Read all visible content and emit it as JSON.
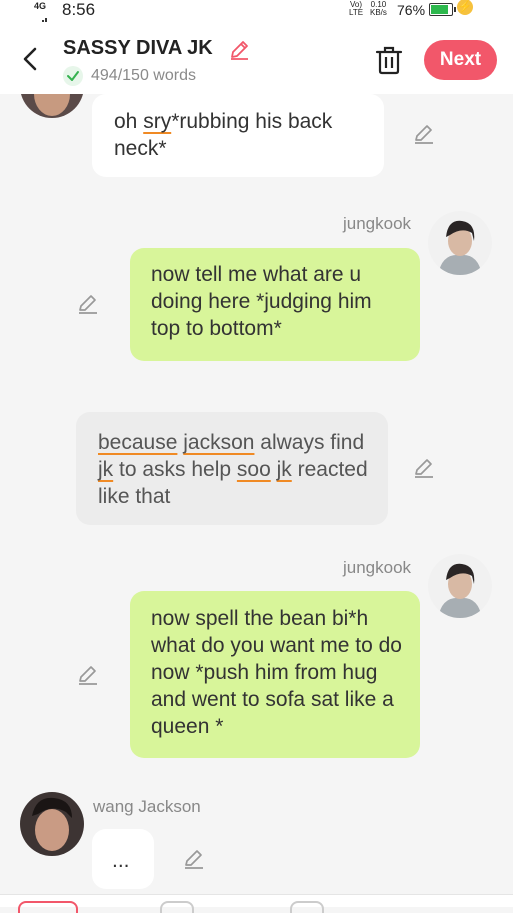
{
  "status_bar": {
    "network": "4G",
    "time": "8:56",
    "volte": "Vo)\nLTE",
    "speed": "0.10\nKB/s",
    "battery": "76%"
  },
  "header": {
    "title": "SASSY DIVA JK",
    "word_count": "494/150 words",
    "next_label": "Next"
  },
  "messages": [
    {
      "sender": "",
      "text": "oh sry*rubbing his back neck*"
    },
    {
      "sender": "jungkook",
      "text": "now tell me what are u doing here *judging him top to bottom*"
    },
    {
      "sender": "",
      "text": "because jackson always find jk to asks help soo jk reacted like that"
    },
    {
      "sender": "jungkook",
      "text": "now spell the bean bi*h what do you want  me to do now  *push him from hug and went to sofa sat like a queen *"
    },
    {
      "sender": "wang Jackson",
      "text": "..."
    }
  ],
  "colors": {
    "accent": "#f2576a",
    "user_bubble": "#d8f59a",
    "narration_bubble": "#ececec",
    "other_bubble": "#ffffff"
  }
}
